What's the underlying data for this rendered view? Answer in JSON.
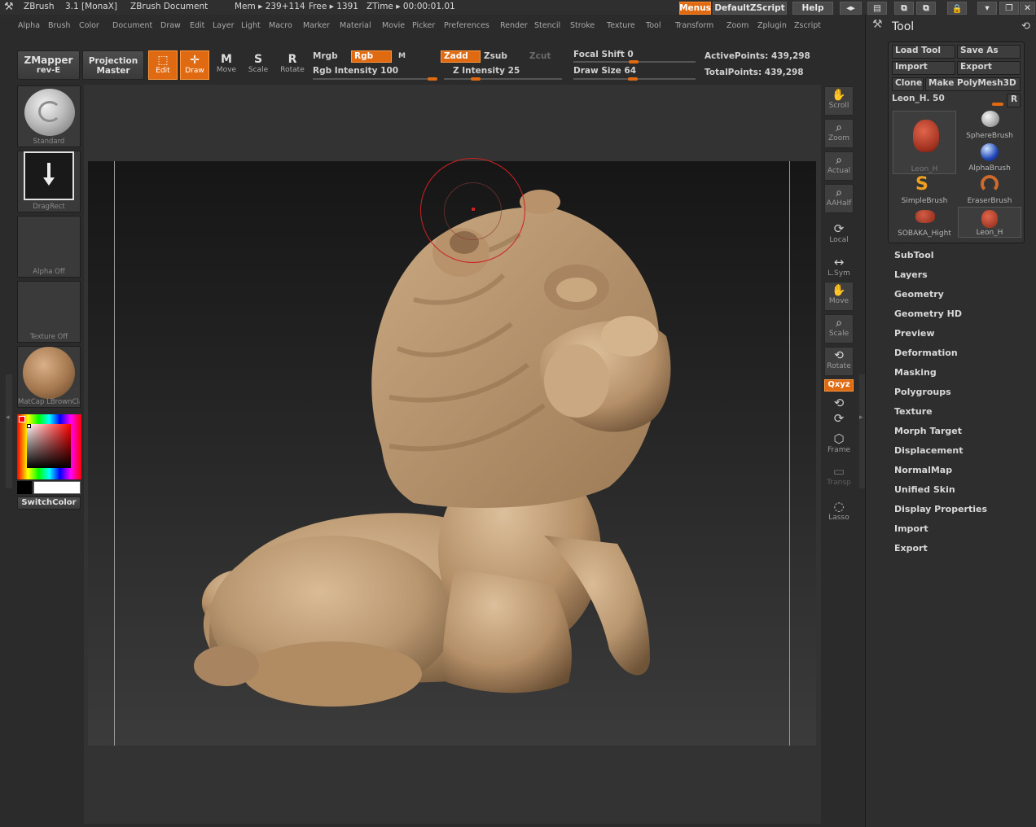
{
  "titlebar": {
    "app": "ZBrush",
    "version": "3.1 [MonaX]",
    "document": "ZBrush Document",
    "mem": "Mem ▸ 239+114",
    "free": "Free ▸ 1391",
    "ztime": "ZTime ▸ 00:00:01.01",
    "menus_btn": "Menus",
    "zscript_btn": "DefaultZScript",
    "help_btn": "Help"
  },
  "menubar": [
    "Alpha",
    "Brush",
    "Color",
    "Document",
    "Draw",
    "Edit",
    "Layer",
    "Light",
    "Macro",
    "Marker",
    "Material",
    "Movie",
    "Picker",
    "Preferences",
    "Render",
    "Stencil",
    "Stroke",
    "Texture",
    "Tool",
    "Transform",
    "Zoom",
    "Zplugin",
    "Zscript"
  ],
  "shelf": {
    "zmapper": "ZMapper",
    "zmapper_sub": "rev-E",
    "projection": "Projection",
    "projection_sub": "Master",
    "edit": "Edit",
    "draw": "Draw",
    "move": "Move",
    "scale": "Scale",
    "rotate": "Rotate",
    "mrgb": "Mrgb",
    "rgb": "Rgb",
    "m": "M",
    "rgb_intensity": "Rgb  Intensity 100",
    "rgb_intensity_value": 100,
    "zadd": "Zadd",
    "zsub": "Zsub",
    "zcut": "Zcut",
    "z_intensity": "Z  Intensity 25",
    "z_intensity_value": 25,
    "focal_shift": "Focal  Shift 0",
    "focal_shift_value": 0,
    "draw_size": "Draw  Size 64",
    "draw_size_value": 64,
    "active_points": "ActivePoints: 439,298",
    "total_points": "TotalPoints: 439,298"
  },
  "lefttray": {
    "brush": "Standard",
    "stroke": "DragRect",
    "alpha": "Alpha  Off",
    "texture": "Texture  Off",
    "material": "MatCap  LBrownClay",
    "switch_color": "SwitchColor"
  },
  "rightshelf": {
    "scroll": "Scroll",
    "zoom": "Zoom",
    "actual": "Actual",
    "aahalf": "AAHalf",
    "local": "Local",
    "lsym": "L.Sym",
    "move": "Move",
    "scale": "Scale",
    "rotate": "Rotate",
    "xyz": "Qxyz",
    "frame": "Frame",
    "transp": "Transp",
    "lasso": "Lasso"
  },
  "toolpanel": {
    "title": "Tool",
    "load_tool": "Load  Tool",
    "save_as": "Save  As",
    "import": "Import",
    "export": "Export",
    "clone": "Clone",
    "make_polymesh": "Make  PolyMesh3D",
    "current_tool": "Leon_H. 50",
    "current_tool_value": 50,
    "r_btn": "R",
    "thumbs": [
      "Leon_H",
      "SphereBrush",
      "AlphaBrush",
      "SimpleBrush",
      "EraserBrush",
      "SOBAKA_Hight",
      "Leon_H"
    ],
    "submenus": [
      "SubTool",
      "Layers",
      "Geometry",
      "Geometry  HD",
      "Preview",
      "Deformation",
      "Masking",
      "Polygroups",
      "Texture",
      "Morph  Target",
      "Displacement",
      "NormalMap",
      "Unified  Skin",
      "Display  Properties",
      "Import",
      "Export"
    ]
  },
  "colors": {
    "accent": "#e06a12",
    "clay": "#c2a07a",
    "brush_cursor": "#cc2222"
  }
}
